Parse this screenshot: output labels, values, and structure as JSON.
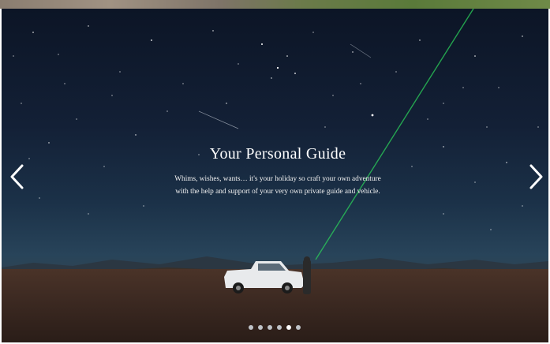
{
  "slide": {
    "title": "Your Personal Guide",
    "description": "Whims, wishes, wants… it's your holiday so craft your own adventure with the help and support of your very own private guide and vehicle."
  },
  "navigation": {
    "prev_icon": "chevron-left-icon",
    "next_icon": "chevron-right-icon"
  },
  "pagination": {
    "total": 6,
    "active_index": 4
  },
  "colors": {
    "sky_top": "#0c1526",
    "horizon": "#28445a",
    "ground": "#3a2a23",
    "laser": "#2bd15a",
    "text": "#ffffff"
  }
}
